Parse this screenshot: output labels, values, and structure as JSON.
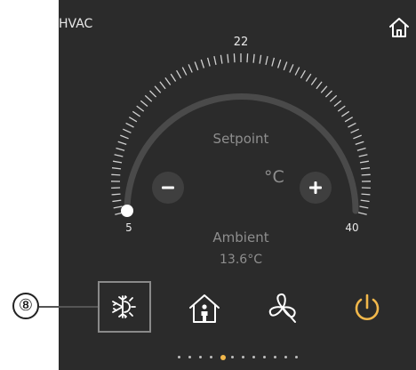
{
  "header": {
    "title": "HVAC",
    "home_icon": "home-icon"
  },
  "thermostat": {
    "setpoint_label": "Setpoint",
    "unit": "°C",
    "ambient_label": "Ambient",
    "ambient_value": "13.6°C",
    "scale_min": "5",
    "scale_mid": "22",
    "scale_max": "40",
    "setpoint_value": 5,
    "range": [
      5,
      40
    ],
    "decrease_icon": "minus-icon",
    "increase_icon": "plus-icon"
  },
  "modes": [
    {
      "name": "cooling",
      "icon": "snowflake-sun-icon",
      "selected": true
    },
    {
      "name": "home-occupancy",
      "icon": "home-person-icon",
      "selected": false
    },
    {
      "name": "fan",
      "icon": "fan-icon",
      "selected": false
    },
    {
      "name": "power",
      "icon": "power-icon",
      "selected": false
    }
  ],
  "pager": {
    "count": 12,
    "active_index": 4
  },
  "annotation": {
    "label": "⑧"
  },
  "colors": {
    "panel": "#2b2b2b",
    "arc_track": "#4a4a4a",
    "ticks": "#d0d0d0",
    "power": "#f2b84b",
    "active_dot": "#f2b84b",
    "text": "#e8e8e8",
    "muted": "#8e8e8e"
  }
}
